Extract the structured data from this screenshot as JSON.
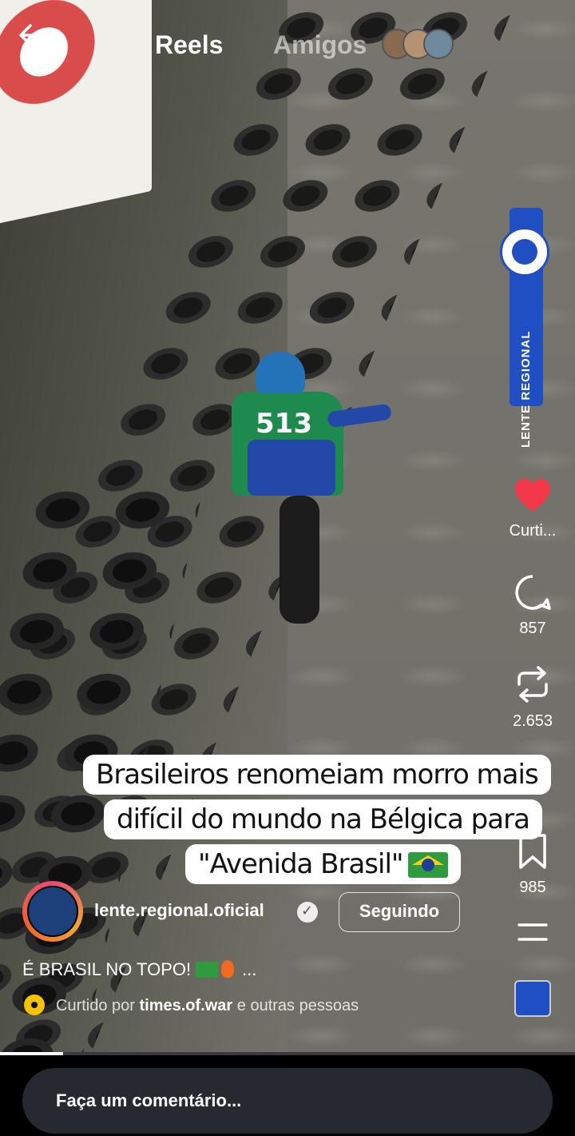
{
  "header": {
    "tabs": [
      {
        "label": "Reels",
        "active": true
      },
      {
        "label": "Amigos",
        "active": false
      }
    ],
    "back_icon": "arrow-left-icon"
  },
  "channel_tag": {
    "text": "LENTE REGIONAL",
    "color": "#1f4fc2"
  },
  "video_overlay": {
    "jersey_number": "513"
  },
  "actions": {
    "like": {
      "label": "Curti...",
      "icon": "heart-filled-icon",
      "color": "#f23849"
    },
    "comment": {
      "count": "857",
      "icon": "comment-bubble-icon"
    },
    "repost": {
      "count": "2.653",
      "icon": "repost-icon"
    },
    "share": {
      "icon": "send-icon"
    },
    "save": {
      "count": "985",
      "icon": "bookmark-icon"
    },
    "more": {
      "icon": "more-icon"
    }
  },
  "caption": {
    "lines": [
      "Brasileiros renomeiam morro mais",
      "difícil do mundo na Bélgica para",
      "\"Avenida Brasil\""
    ]
  },
  "author": {
    "username": "lente.regional.oficial",
    "verified": true,
    "follow_label": "Seguindo"
  },
  "description": {
    "text": "É BRASIL NO TOPO!",
    "more": "..."
  },
  "liked_by": {
    "prefix": "Curtido por",
    "user": "times.of.war",
    "suffix": "e outras pessoas"
  },
  "playback": {
    "progress": 0.11
  },
  "comment_box": {
    "placeholder": "Faça um comentário..."
  }
}
